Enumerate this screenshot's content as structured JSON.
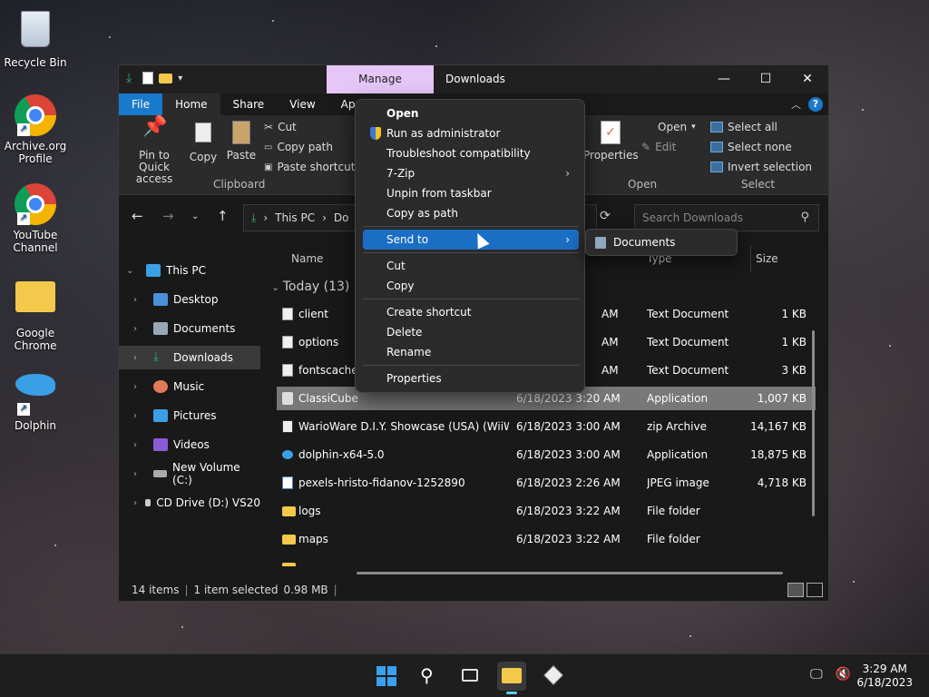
{
  "desktop": {
    "icons": [
      {
        "label": "Recycle Bin"
      },
      {
        "label": "Archive.org Profile"
      },
      {
        "label": "YouTube Channel"
      },
      {
        "label": "Google Chrome"
      },
      {
        "label": "Dolphin"
      }
    ]
  },
  "window": {
    "manage_tab": "Manage",
    "title": "Downloads",
    "ribbon_tabs": [
      "File",
      "Home",
      "Share",
      "View",
      "Appl"
    ],
    "clipboard": {
      "pin": "Pin to Quick access",
      "copy": "Copy",
      "paste": "Paste",
      "cut": "Cut",
      "copy_path": "Copy path",
      "paste_shortcut": "Paste shortcut",
      "label": "Clipboard"
    },
    "open_group": {
      "properties": "Properties",
      "open": "Open",
      "edit": "Edit",
      "label": "Open"
    },
    "select_group": {
      "select_all": "Select all",
      "select_none": "Select none",
      "invert": "Invert selection",
      "label": "Select"
    },
    "address": {
      "root": "This PC",
      "current": "Do"
    },
    "search_placeholder": "Search Downloads",
    "nav": [
      {
        "label": "This PC"
      },
      {
        "label": "Desktop"
      },
      {
        "label": "Documents"
      },
      {
        "label": "Downloads"
      },
      {
        "label": "Music"
      },
      {
        "label": "Pictures"
      },
      {
        "label": "Videos"
      },
      {
        "label": "New Volume (C:)"
      },
      {
        "label": "CD Drive (D:) VS20"
      }
    ],
    "columns": {
      "name": "Name",
      "type": "Type",
      "size": "Size"
    },
    "group_header": "Today (13)",
    "files": [
      {
        "name": "client",
        "date": "AM",
        "type": "Text Document",
        "size": "1 KB",
        "icon": "doc"
      },
      {
        "name": "options",
        "date": "AM",
        "type": "Text Document",
        "size": "1 KB",
        "icon": "doc"
      },
      {
        "name": "fontscache",
        "date": "AM",
        "type": "Text Document",
        "size": "3 KB",
        "icon": "doc"
      },
      {
        "name": "ClassiCube",
        "date": "6/18/2023 3:20 AM",
        "type": "Application",
        "size": "1,007 KB",
        "icon": "app"
      },
      {
        "name": "WarioWare D.I.Y. Showcase (USA) (WiiWa...",
        "date": "6/18/2023 3:00 AM",
        "type": "zip Archive",
        "size": "14,167 KB",
        "icon": "zip"
      },
      {
        "name": "dolphin-x64-5.0",
        "date": "6/18/2023 3:00 AM",
        "type": "Application",
        "size": "18,875 KB",
        "icon": "dolphin"
      },
      {
        "name": "pexels-hristo-fidanov-1252890",
        "date": "6/18/2023 2:26 AM",
        "type": "JPEG image",
        "size": "4,718 KB",
        "icon": "jpg"
      },
      {
        "name": "logs",
        "date": "6/18/2023 3:22 AM",
        "type": "File folder",
        "size": "",
        "icon": "folder"
      },
      {
        "name": "maps",
        "date": "6/18/2023 3:22 AM",
        "type": "File folder",
        "size": "",
        "icon": "folder"
      }
    ],
    "status": {
      "count": "14 items",
      "selected": "1 item selected",
      "size": "0.98 MB"
    }
  },
  "context_menu": {
    "items": [
      {
        "label": "Open"
      },
      {
        "label": "Run as administrator"
      },
      {
        "label": "Troubleshoot compatibility"
      },
      {
        "label": "7-Zip"
      },
      {
        "label": "Unpin from taskbar"
      },
      {
        "label": "Copy as path"
      },
      {
        "label": "Send to"
      },
      {
        "label": "Cut"
      },
      {
        "label": "Copy"
      },
      {
        "label": "Create shortcut"
      },
      {
        "label": "Delete"
      },
      {
        "label": "Rename"
      },
      {
        "label": "Properties"
      }
    ],
    "submenu": {
      "documents": "Documents"
    }
  },
  "taskbar": {
    "time": "3:29 AM",
    "date": "6/18/2023"
  },
  "colors": {
    "accent": "#1979ca",
    "manage_tab": "#e5c6f7",
    "menu_highlight": "#1a6fc4"
  }
}
